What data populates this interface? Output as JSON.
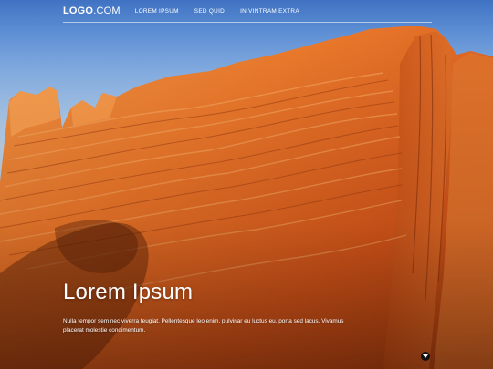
{
  "header": {
    "logo": {
      "bold": "LOGO",
      "light": ".COM"
    },
    "nav": [
      {
        "label": "LOREM IPSUM"
      },
      {
        "label": "SED QUID"
      },
      {
        "label": "IN VINTRAM EXTRA"
      }
    ]
  },
  "hero": {
    "title": "Lorem Ipsum",
    "text": "Nulla tempor sem nec viverra feugiat. Pellentesque leo enim, pulvinar eu luctus eu, porta sed lacus. Vivamus placerat molestie condimentum.",
    "scroll_icon": "chevron-down-icon"
  },
  "colors": {
    "sky": "#86b3ea",
    "rock_light": "#f08a3c",
    "rock_mid": "#d9621e",
    "rock_dark": "#7a2e0e"
  }
}
